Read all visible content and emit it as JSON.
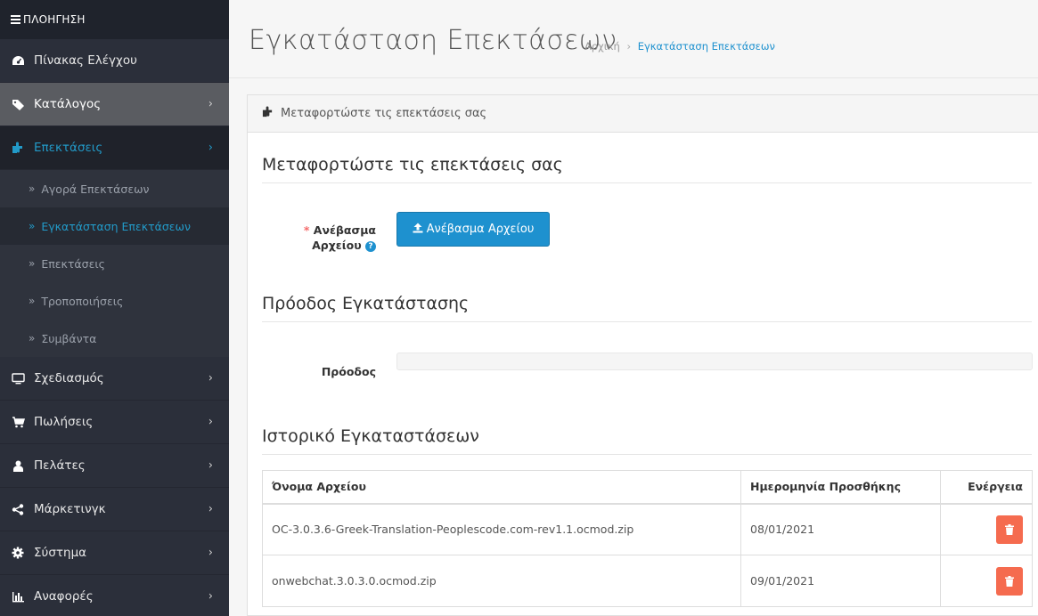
{
  "nav": {
    "title": "ΠΛΟΗΓΗΣΗ",
    "items": [
      {
        "label": "Πίνακας Ελέγχου",
        "icon": "dashboard-icon"
      },
      {
        "label": "Κατάλογος",
        "icon": "tag-icon"
      },
      {
        "label": "Επεκτάσεις",
        "icon": "puzzle-icon"
      },
      {
        "label": "Σχεδιασμός",
        "icon": "monitor-icon"
      },
      {
        "label": "Πωλήσεις",
        "icon": "cart-icon"
      },
      {
        "label": "Πελάτες",
        "icon": "user-icon"
      },
      {
        "label": "Μάρκετινγκ",
        "icon": "share-icon"
      },
      {
        "label": "Σύστημα",
        "icon": "gear-icon"
      },
      {
        "label": "Αναφορές",
        "icon": "bar-chart-icon"
      }
    ],
    "sub": [
      {
        "label": "Αγορά Επεκτάσεων"
      },
      {
        "label": "Εγκατάσταση Επεκτάσεων"
      },
      {
        "label": "Επεκτάσεις"
      },
      {
        "label": "Τροποποιήσεις"
      },
      {
        "label": "Συμβάντα"
      }
    ],
    "colors": {
      "active": "#229ac8",
      "sidebar": "#2b2f3a"
    }
  },
  "header": {
    "title": "Εγκατάσταση Επεκτάσεων",
    "breadcrumb": [
      "Αρχική",
      "Εγκατάσταση Επεκτάσεων"
    ]
  },
  "panel": {
    "heading": "Μεταφορτώστε τις επεκτάσεις σας",
    "upload_section": "Μεταφορτώστε τις επεκτάσεις σας",
    "upload_label_line1": "Ανέβασμα",
    "upload_label_line2": "Αρχείου",
    "upload_button": "Ανέβασμα Αρχείου",
    "progress_section": "Πρόοδος Εγκατάστασης",
    "progress_label": "Πρόοδος",
    "progress_value": 0,
    "history_section": "Ιστορικό Εγκαταστάσεων"
  },
  "table": {
    "headers": [
      "Όνομα Αρχείου",
      "Ημερομηνία Προσθήκης",
      "Ενέργεια"
    ],
    "rows": [
      {
        "file": "OC-3.0.3.6-Greek-Translation-Peoplescode.com-rev1.1.ocmod.zip",
        "date": "08/01/2021"
      },
      {
        "file": "onwebchat.3.0.3.0.ocmod.zip",
        "date": "09/01/2021"
      }
    ]
  }
}
